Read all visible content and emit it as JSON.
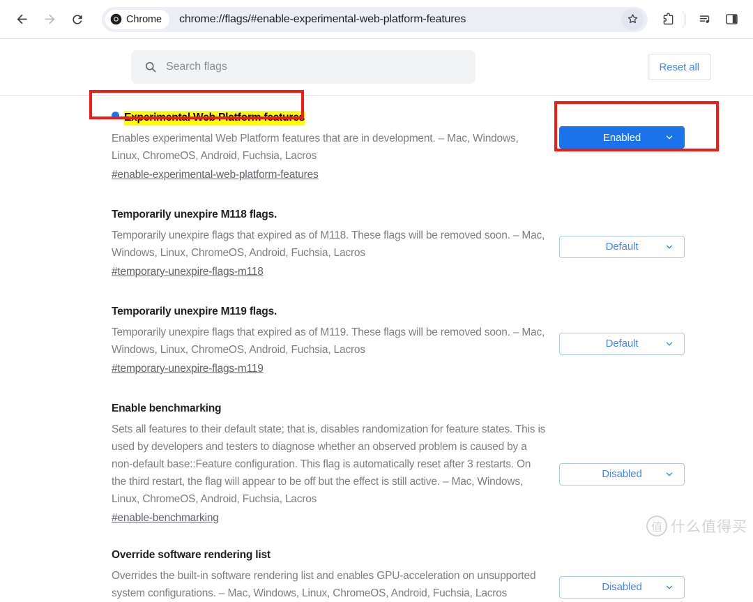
{
  "browser": {
    "back_icon": "arrow-left-icon",
    "forward_icon": "arrow-right-icon",
    "reload_icon": "reload-icon",
    "chrome_chip_label": "Chrome",
    "url": "chrome://flags/#enable-experimental-web-platform-features",
    "bookmark_icon": "star-icon",
    "extensions_icon": "puzzle-piece-icon",
    "media_icon": "media-list-icon",
    "side_panel_icon": "side-panel-icon"
  },
  "flags_page": {
    "search": {
      "placeholder": "Search flags",
      "value": ""
    },
    "reset_all_label": "Reset all",
    "flags": [
      {
        "title": "Experimental Web Platform features",
        "description": "Enables experimental Web Platform features that are in development. – Mac, Windows, Linux, ChromeOS, Android, Fuchsia, Lacros",
        "anchor": "#enable-experimental-web-platform-features",
        "select_value": "Enabled",
        "state": "active",
        "highlighted": true,
        "has_dot": true
      },
      {
        "title": "Temporarily unexpire M118 flags.",
        "description": "Temporarily unexpire flags that expired as of M118. These flags will be removed soon. – Mac, Windows, Linux, ChromeOS, Android, Fuchsia, Lacros",
        "anchor": "#temporary-unexpire-flags-m118",
        "select_value": "Default",
        "state": "plain",
        "highlighted": false,
        "has_dot": false
      },
      {
        "title": "Temporarily unexpire M119 flags.",
        "description": "Temporarily unexpire flags that expired as of M119. These flags will be removed soon. – Mac, Windows, Linux, ChromeOS, Android, Fuchsia, Lacros",
        "anchor": "#temporary-unexpire-flags-m119",
        "select_value": "Default",
        "state": "plain",
        "highlighted": false,
        "has_dot": false
      },
      {
        "title": "Enable benchmarking",
        "description": "Sets all features to their default state; that is, disables randomization for feature states. This is used by developers and testers to diagnose whether an observed problem is caused by a non-default base::Feature configuration. This flag is automatically reset after 3 restarts. On the third restart, the flag will appear to be off but the effect is still active. – Mac, Windows, Linux, ChromeOS, Android, Fuchsia, Lacros",
        "anchor": "#enable-benchmarking",
        "select_value": "Disabled",
        "state": "plain",
        "highlighted": false,
        "has_dot": false
      },
      {
        "title": "Override software rendering list",
        "description": "Overrides the built-in software rendering list and enables GPU-acceleration on unsupported system configurations. – Mac, Windows, Linux, ChromeOS, Android, Fuchsia, Lacros",
        "anchor": "",
        "select_value": "Disabled",
        "state": "plain",
        "highlighted": false,
        "has_dot": false
      }
    ]
  },
  "annotations": {
    "highlight_color": "#ffff00",
    "box_color": "#f41b17",
    "accent_blue": "#1a73e8"
  },
  "watermark": {
    "mark": "值",
    "text": "什么值得买"
  }
}
